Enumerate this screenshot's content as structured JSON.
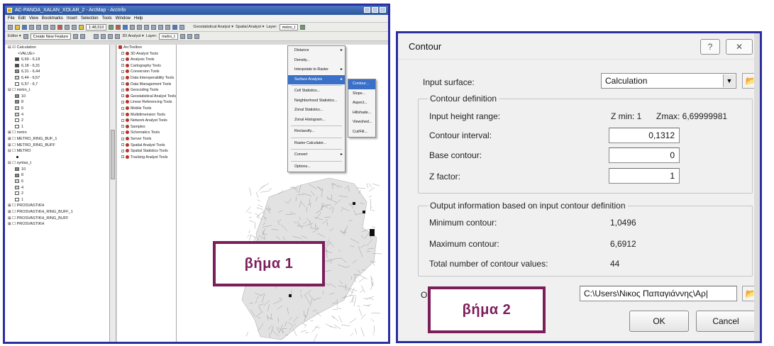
{
  "arcmap": {
    "window_title": "AC-PANOA_XALAN_XOLAR_2 - ArcMap - ArcInfo",
    "menubar": [
      "File",
      "Edit",
      "View",
      "Bookmarks",
      "Insert",
      "Selection",
      "Tools",
      "Window",
      "Help"
    ],
    "toolbar1": {
      "scale": "1:48,510",
      "geostat": "Geostatistical Analyst ▾",
      "spatial": "Spatial Analyst ▾",
      "layer_label": "Layer:",
      "layer_value": "metro_t"
    },
    "toolbar2": {
      "editor": "Editor ▾",
      "create_features": "Create New Feature",
      "analyst3d": "3D Analyst ▾",
      "layer_label": "Layer:",
      "layer_value": "metro_t"
    },
    "toc": [
      {
        "text": "⊟ ☑ Calculation",
        "indent": 0,
        "sw": ""
      },
      {
        "text": "<VALUE>",
        "indent": 14,
        "sw": ""
      },
      {
        "text": "6,69 - 6,18",
        "indent": 10,
        "sw": "dark"
      },
      {
        "text": "6,18 - 6,31",
        "indent": 10,
        "sw": "dark"
      },
      {
        "text": "6,31 - 6,44",
        "indent": 10,
        "sw": "mid"
      },
      {
        "text": "6,44 - 6,57",
        "indent": 10,
        "sw": "light"
      },
      {
        "text": "6,57 - 6,7",
        "indent": 10,
        "sw": "white"
      },
      {
        "text": "⊟ ☐ metro_t",
        "indent": 0,
        "sw": ""
      },
      {
        "text": "10",
        "indent": 10,
        "sw": "mid"
      },
      {
        "text": "8",
        "indent": 10,
        "sw": "mid"
      },
      {
        "text": "6",
        "indent": 10,
        "sw": "light"
      },
      {
        "text": "4",
        "indent": 10,
        "sw": "light"
      },
      {
        "text": "2",
        "indent": 10,
        "sw": "white"
      },
      {
        "text": "1",
        "indent": 10,
        "sw": "white"
      },
      {
        "text": "⊞ ☐ metro",
        "indent": 0,
        "sw": ""
      },
      {
        "text": "⊞ ☐ METRO_RING_BUF_1",
        "indent": 0,
        "sw": ""
      },
      {
        "text": "⊞ ☐ METRO_RING_BUFF",
        "indent": 0,
        "sw": ""
      },
      {
        "text": "⊟ ☐ METRO",
        "indent": 0,
        "sw": ""
      },
      {
        "text": "",
        "indent": 12,
        "sw": "dot"
      },
      {
        "text": "⊟ ☐ syntax_t",
        "indent": 0,
        "sw": ""
      },
      {
        "text": "10",
        "indent": 10,
        "sw": "mid"
      },
      {
        "text": "8",
        "indent": 10,
        "sw": "mid"
      },
      {
        "text": "6",
        "indent": 10,
        "sw": "light"
      },
      {
        "text": "4",
        "indent": 10,
        "sw": "light"
      },
      {
        "text": "2",
        "indent": 10,
        "sw": "white"
      },
      {
        "text": "1",
        "indent": 10,
        "sw": "white"
      },
      {
        "text": "⊞ ☐ PROSVASTIKH",
        "indent": 0,
        "sw": ""
      },
      {
        "text": "⊞ ☐ PROSVASTIKH_RING_BUFF_1",
        "indent": 0,
        "sw": ""
      },
      {
        "text": "⊞ ☐ PROSVASTIKH_RING_BUFF",
        "indent": 0,
        "sw": ""
      },
      {
        "text": "⊞ ☐ PROSVASTIKH",
        "indent": 0,
        "sw": ""
      }
    ],
    "toolbox": {
      "root": "ArcToolbox",
      "items": [
        "3D Analyst Tools",
        "Analysis Tools",
        "Cartography Tools",
        "Conversion Tools",
        "Data Interoperability Tools",
        "Data Management Tools",
        "Geocoding Tools",
        "Geostatistical Analyst Tools",
        "Linear Referencing Tools",
        "Mobile Tools",
        "Multidimension Tools",
        "Network Analyst Tools",
        "Samples",
        "Schematics Tools",
        "Server Tools",
        "Spatial Analyst Tools",
        "Spatial Statistics Tools",
        "Tracking Analyst Tools"
      ]
    },
    "menu1": [
      {
        "label": "Distance",
        "sub": true,
        "sel": false
      },
      {
        "label": "Density...",
        "sub": false,
        "sel": false
      },
      {
        "label": "Interpolate to Raster",
        "sub": true,
        "sel": false
      },
      {
        "label": "Surface Analysis",
        "sub": true,
        "sel": true
      },
      {
        "label": "Cell Statistics...",
        "sub": false,
        "sel": false
      },
      {
        "label": "Neighborhood Statistics...",
        "sub": false,
        "sel": false
      },
      {
        "label": "Zonal Statistics...",
        "sub": false,
        "sel": false
      },
      {
        "label": "Zonal Histogram...",
        "sub": false,
        "sel": false
      },
      {
        "label": "Reclassify...",
        "sub": false,
        "sel": false
      },
      {
        "label": "Raster Calculator...",
        "sub": false,
        "sel": false
      },
      {
        "label": "Convert",
        "sub": true,
        "sel": false
      },
      {
        "label": "Options...",
        "sub": false,
        "sel": false
      }
    ],
    "menu2": [
      {
        "label": "Contour...",
        "sel": true
      },
      {
        "label": "Slope...",
        "sel": false
      },
      {
        "label": "Aspect...",
        "sel": false
      },
      {
        "label": "Hillshade...",
        "sel": false
      },
      {
        "label": "Viewshed...",
        "sel": false
      },
      {
        "label": "Cut/Fill...",
        "sel": false
      }
    ]
  },
  "badges": {
    "step1": "βήμα 1",
    "step2": "βήμα 2"
  },
  "dialog": {
    "title": "Contour",
    "help_glyph": "?",
    "close_glyph": "✕",
    "input_surface_label": "Input surface:",
    "input_surface_value": "Calculation",
    "contour_definition_legend": "Contour definition",
    "input_height_range_label": "Input height range:",
    "zmin": "Z min: 1",
    "zmax": "Zmax: 6,69999981",
    "contour_interval_label": "Contour interval:",
    "contour_interval_value": "0,1312",
    "base_contour_label": "Base contour:",
    "base_contour_value": "0",
    "z_factor_label": "Z factor:",
    "z_factor_value": "1",
    "output_info_legend": "Output information based on input contour definition",
    "min_contour_label": "Minimum contour:",
    "min_contour_value": "1,0496",
    "max_contour_label": "Maximum contour:",
    "max_contour_value": "6,6912",
    "total_label": "Total number of contour values:",
    "total_value": "44",
    "output_label_partial": "O",
    "output_path": "C:\\Users\\Νικος Παπαγιάννης\\Αρ|",
    "ok_label": "OK",
    "cancel_label": "Cancel",
    "dropdown_glyph": "▼",
    "folder_glyph": "📂"
  },
  "colors": {
    "badge": "#7b1e5a",
    "frame": "#2c2ea0",
    "menu_highlight": "#3a70c8"
  }
}
